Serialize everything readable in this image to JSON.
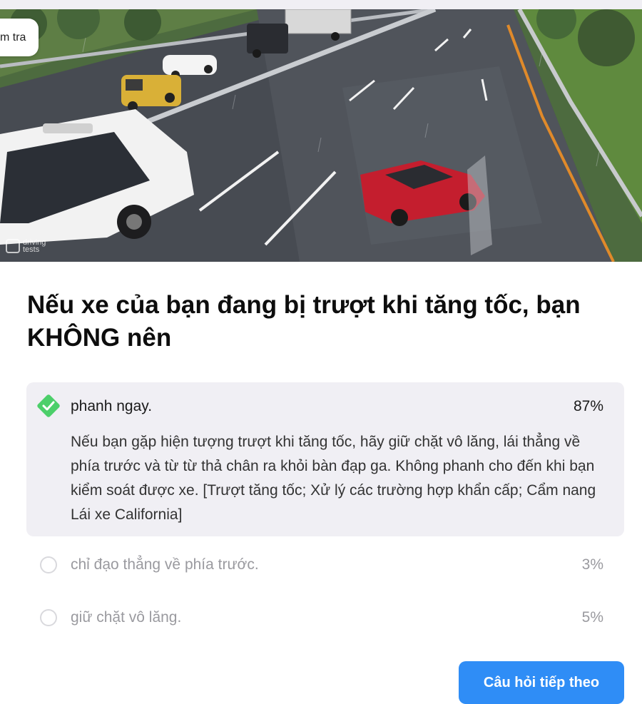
{
  "hero": {
    "badge_text": "m tra",
    "watermark_line1": "driving",
    "watermark_line2": "tests"
  },
  "question": {
    "title": "Nếu xe của bạn đang bị trượt khi tăng tốc, bạn KHÔNG nên"
  },
  "answers": [
    {
      "text": "phanh ngay.",
      "percent": "87%",
      "correct": true,
      "explanation": "Nếu bạn gặp hiện tượng trượt khi tăng tốc, hãy giữ chặt vô lăng, lái thẳng về phía trước và từ từ thả chân ra khỏi bàn đạp ga. Không phanh cho đến khi bạn kiểm soát được xe. [Trượt tăng tốc; Xử lý các trường hợp khẩn cấp; Cẩm nang Lái xe California]"
    },
    {
      "text": "chỉ đạo thẳng về phía trước.",
      "percent": "3%",
      "correct": false
    },
    {
      "text": "giữ chặt vô lăng.",
      "percent": "5%",
      "correct": false
    }
  ],
  "next_button": {
    "label": "Câu hỏi tiếp theo"
  },
  "colors": {
    "accent_blue": "#2f8df6",
    "correct_green": "#4ccf6a",
    "selected_bg": "#f0eff4"
  }
}
